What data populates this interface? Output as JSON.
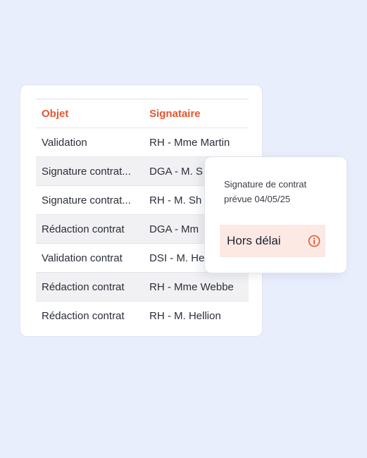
{
  "table": {
    "headers": {
      "objet": "Objet",
      "signataire": "Signataire"
    },
    "rows": [
      {
        "objet": "Validation",
        "signataire": "RH - Mme Martin"
      },
      {
        "objet": "Signature contrat...",
        "signataire": "DGA - M. S"
      },
      {
        "objet": "Signature contrat...",
        "signataire": "RH - M. Sh"
      },
      {
        "objet": "Rédaction contrat",
        "signataire": "DGA - Mm"
      },
      {
        "objet": "Validation contrat",
        "signataire": "DSI - M. He"
      },
      {
        "objet": "Rédaction contrat",
        "signataire": "RH - Mme Webbe"
      },
      {
        "objet": "Rédaction contrat",
        "signataire": "RH - M. Hellion"
      }
    ]
  },
  "tooltip": {
    "line1": "Signature de contrat",
    "line2": "prévue 04/05/25",
    "status": "Hors délai",
    "status_icon": "info-icon"
  },
  "colors": {
    "accent": "#e5552e",
    "background": "#e9eefc",
    "status_bg": "#fce9e3"
  }
}
